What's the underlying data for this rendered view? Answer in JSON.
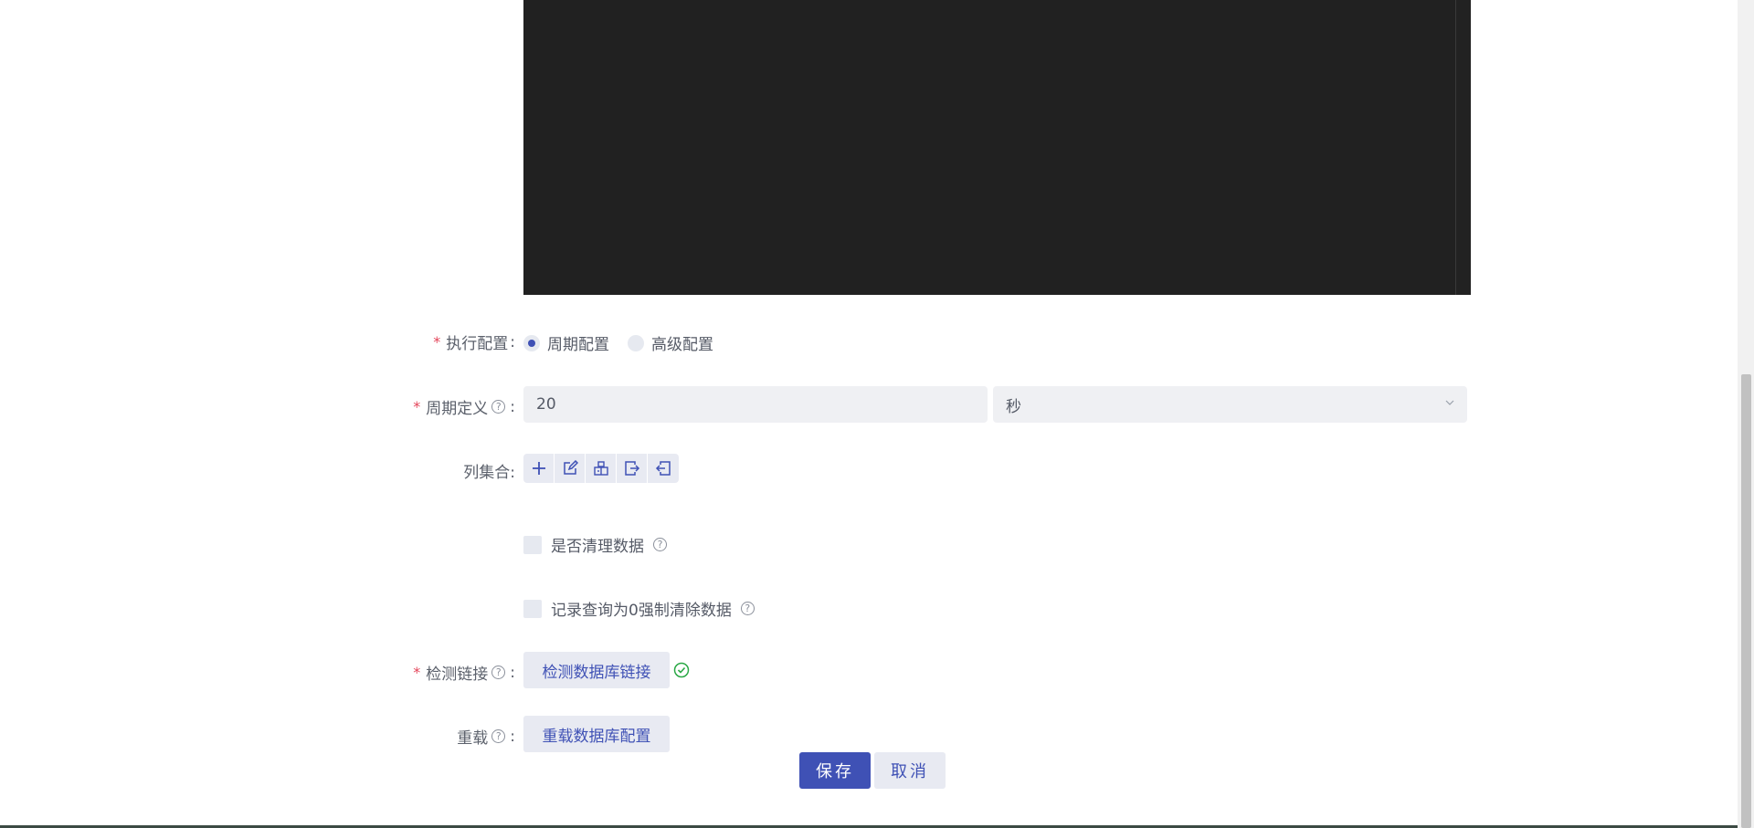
{
  "execution": {
    "label": "执行配置",
    "colon": ":",
    "options": [
      {
        "label": "周期配置",
        "checked": true
      },
      {
        "label": "高级配置",
        "checked": false
      }
    ]
  },
  "period": {
    "label": "周期定义",
    "help": "?",
    "colon": ":",
    "value": "20",
    "unit": "秒"
  },
  "columns": {
    "label": "列集合:",
    "tools": [
      "plus-icon",
      "edit-icon",
      "building-icon",
      "export-icon",
      "import-icon"
    ]
  },
  "clean_data": {
    "label": "是否清理数据",
    "help": "?"
  },
  "force_clear": {
    "label": "记录查询为0强制清除数据",
    "help": "?"
  },
  "check_link": {
    "label": "检测链接",
    "help": "?",
    "colon": ":",
    "button": "检测数据库链接",
    "status_icon": "check-circle-icon",
    "status_color": "#2aa845"
  },
  "reload": {
    "label": "重载",
    "help": "?",
    "colon": ":",
    "button": "重载数据库配置"
  },
  "footer": {
    "save": "保存",
    "cancel": "取消"
  },
  "colors": {
    "primary": "#3f51b5",
    "required": "#e4455a",
    "editor_bg": "#212121"
  }
}
